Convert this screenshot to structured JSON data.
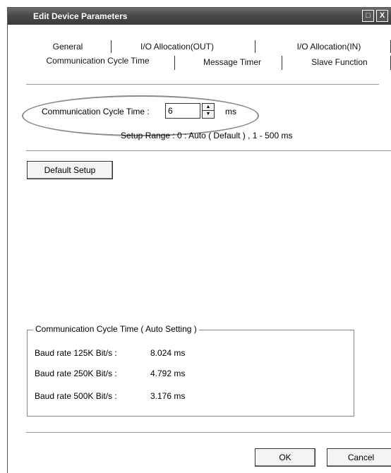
{
  "window": {
    "title": "Edit Device Parameters",
    "sys_buttons": [
      "□",
      "X"
    ]
  },
  "tabs": {
    "row1": [
      "General",
      "I/O Allocation(OUT)",
      "I/O Allocation(IN)"
    ],
    "row2": [
      "Communication Cycle Time",
      "Message Timer",
      "Slave Function"
    ],
    "active": "Communication Cycle Time"
  },
  "cycle": {
    "label": "Communication Cycle Time :",
    "value": "6",
    "unit": "ms",
    "range_text": "Setup Range :   0 : Auto ( Default ) ,  1 - 500 ms"
  },
  "default_button": "Default Setup",
  "auto_group": {
    "title": "Communication Cycle Time ( Auto Setting )",
    "rows": [
      {
        "label": "Baud rate 125K Bit/s :",
        "value": "8.024 ms"
      },
      {
        "label": "Baud rate 250K Bit/s :",
        "value": "4.792 ms"
      },
      {
        "label": "Baud rate 500K Bit/s :",
        "value": "3.176 ms"
      }
    ]
  },
  "footer": {
    "ok": "OK",
    "cancel": "Cancel"
  }
}
